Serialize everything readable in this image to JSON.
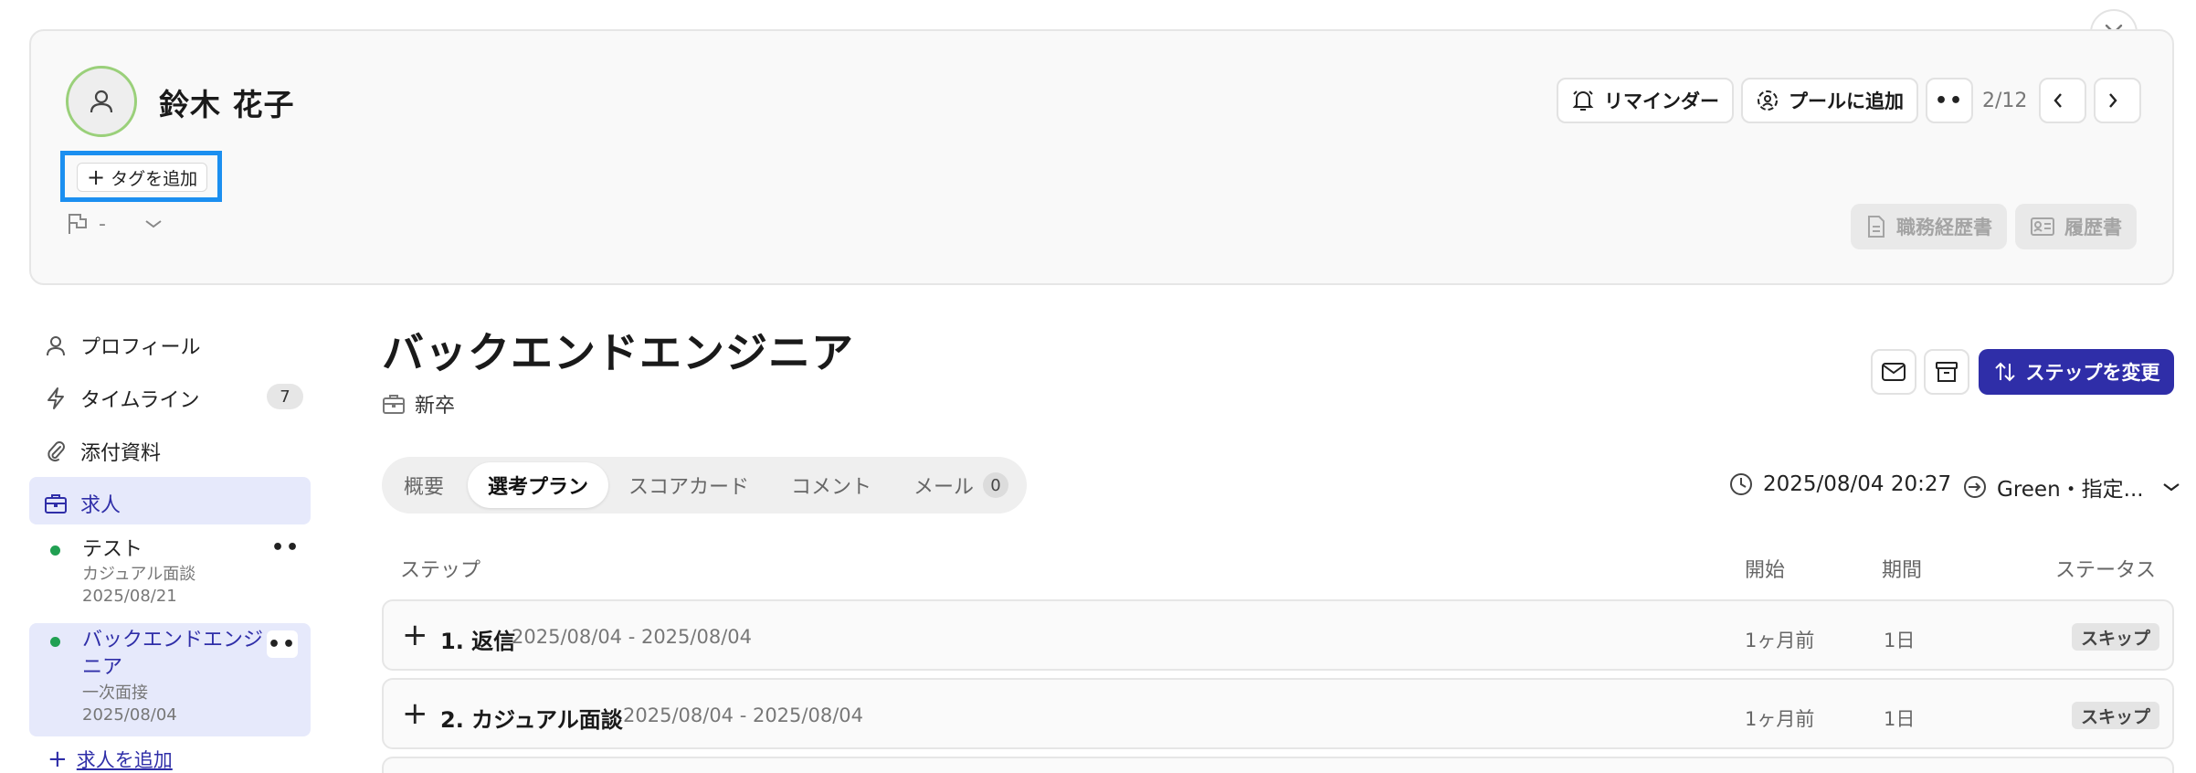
{
  "candidate": {
    "name": "鈴木 花子",
    "flag_value": "-"
  },
  "tags": {
    "add_label": "タグを追加"
  },
  "header": {
    "reminder_label": "リマインダー",
    "add_to_pool_label": "プールに追加",
    "more_label": "••",
    "pager": "2/12",
    "resume_work_label": "職務経歴書",
    "resume_label": "履歴書"
  },
  "sidebar": {
    "items": [
      {
        "label": "プロフィール",
        "icon": "user-icon"
      },
      {
        "label": "タイムライン",
        "icon": "bolt-icon",
        "count": "7"
      },
      {
        "label": "添付資料",
        "icon": "paperclip-icon"
      },
      {
        "label": "求人",
        "icon": "briefcase-icon"
      }
    ],
    "jobs": [
      {
        "title": "テスト",
        "stage": "カジュアル面談",
        "date": "2025/08/21",
        "status_color": "#21a052"
      },
      {
        "title_line1": "バックエンドエンジ",
        "title_line2": "ニア",
        "stage": "一次面接",
        "date": "2025/08/04",
        "status_color": "#21a052"
      }
    ],
    "add_job_label": "求人を追加",
    "more_label": "••"
  },
  "main": {
    "job_title": "バックエンドエンジニア",
    "employment_type": "新卒",
    "change_step_label": "ステップを変更",
    "accent_color": "#2f2ea8",
    "tabs": [
      {
        "label": "概要"
      },
      {
        "label": "選考プラン",
        "active": true
      },
      {
        "label": "スコアカード"
      },
      {
        "label": "コメント"
      },
      {
        "label": "メール",
        "count": "0"
      }
    ],
    "datetime": "2025/08/04 20:27",
    "assignee": "Green・指定...",
    "columns": {
      "step": "ステップ",
      "start": "開始",
      "duration": "期間",
      "status": "ステータス"
    },
    "steps": [
      {
        "title": "1. 返信",
        "range": "2025/08/04 - 2025/08/04",
        "start": "1ヶ月前",
        "duration": "1日",
        "status": "スキップ"
      },
      {
        "title": "2. カジュアル面談",
        "range": "2025/08/04 - 2025/08/04",
        "start": "1ヶ月前",
        "duration": "1日",
        "status": "スキップ"
      }
    ]
  }
}
